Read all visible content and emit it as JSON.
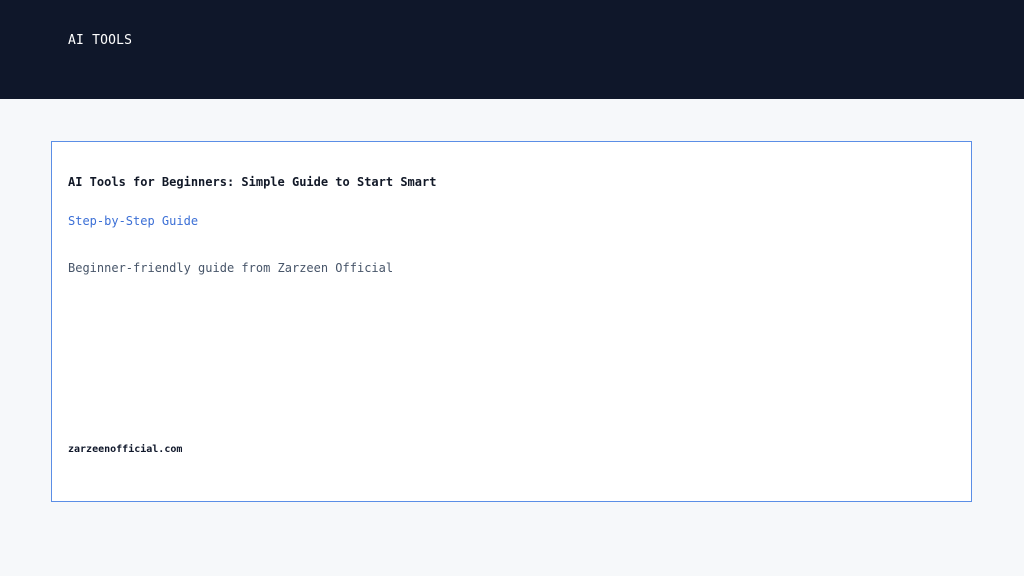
{
  "header": {
    "brand": "AI TOOLS"
  },
  "card": {
    "title": "AI Tools for Beginners: Simple Guide to Start Smart",
    "subtitle": "Step-by-Step Guide",
    "description": "Beginner-friendly guide from Zarzeen Official",
    "site": "zarzeenofficial.com"
  },
  "colors": {
    "header_background": "#0f172a",
    "page_background": "#f6f8fa",
    "card_background": "#ffffff",
    "card_border": "#5b8ee6",
    "subtitle": "#3b6fd6",
    "description": "#475569"
  }
}
